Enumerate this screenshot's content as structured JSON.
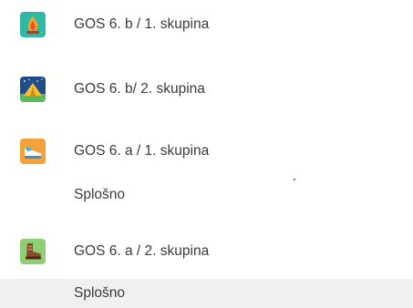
{
  "teams": [
    {
      "name": "GOS 6. b / 1. skupina",
      "icon": "campfire-icon",
      "icon_color": "#2fb8a4"
    },
    {
      "name": "GOS 6. b/ 2. skupina",
      "icon": "tent-icon",
      "icon_color": "#1f4e86"
    },
    {
      "name": "GOS 6. a / 1. skupina",
      "icon": "sneaker-icon",
      "icon_color": "#f3a13b",
      "channels": [
        {
          "name": "Splošno",
          "selected": false
        }
      ]
    },
    {
      "name": "GOS 6. a / 2. skupina",
      "icon": "hiking-boot-icon",
      "icon_color": "#8ecf73",
      "channels": [
        {
          "name": "Splošno",
          "selected": true
        }
      ]
    }
  ],
  "colors": {
    "text": "#3a3a3a",
    "selected_background": "#f0f0f0"
  }
}
